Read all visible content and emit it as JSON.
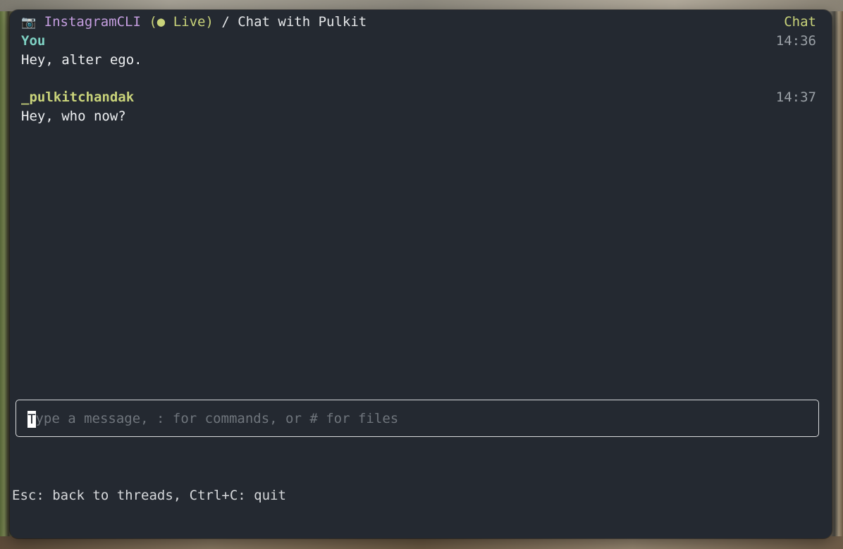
{
  "header": {
    "icon": "camera-icon",
    "app_name": "InstagramCLI",
    "status_open": " (",
    "status_dot": "●",
    "status_label": " Live)",
    "separator": " / ",
    "title": "Chat with Pulkit",
    "mode_label": "Chat"
  },
  "messages": [
    {
      "sender": "You",
      "time": "14:36",
      "text": "Hey, alter ego."
    },
    {
      "sender": "_pulkitchandak",
      "time": "14:37",
      "text": "Hey, who now?"
    }
  ],
  "composer": {
    "placeholder": "Type a message, : for commands, or # for files",
    "value": "",
    "cursor_char": "T"
  },
  "footer": {
    "hint": "Esc: back to threads, Ctrl+C: quit"
  },
  "colors": {
    "window_bg": "#242931",
    "app_name": "#c59ee0",
    "live": "#c9d37a",
    "sender_you": "#7fd2c4",
    "sender_other": "#c9d37a",
    "timestamp": "#9aa0a6"
  }
}
